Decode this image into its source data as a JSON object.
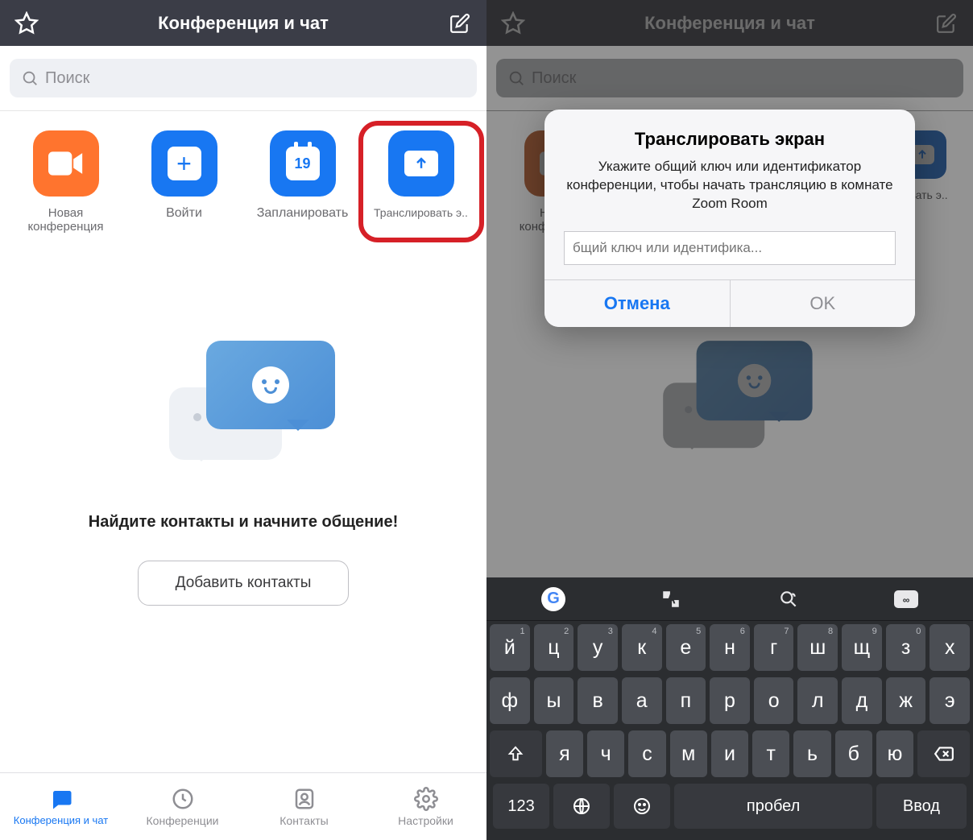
{
  "header": {
    "title": "Конференция и чат"
  },
  "search": {
    "placeholder": "Поиск"
  },
  "actions": {
    "new_meeting": "Новая\nконференция",
    "join": "Войти",
    "schedule": "Запланировать",
    "share": "Транслировать э..",
    "share_short": "ровать э..",
    "calendar_day": "19"
  },
  "empty": {
    "title": "Найдите контакты и начните общение!",
    "button": "Добавить контакты"
  },
  "tabs": {
    "chat": "Конференция и чат",
    "meetings": "Конференции",
    "contacts": "Контакты",
    "settings": "Настройки"
  },
  "dialog": {
    "title": "Транслировать экран",
    "message": "Укажите общий ключ или идентификатор конференции, чтобы начать трансляцию в комнате Zoom Room",
    "placeholder": "бщий ключ или идентифика...",
    "cancel": "Отмена",
    "ok": "OK"
  },
  "keyboard": {
    "row1": [
      "й",
      "ц",
      "у",
      "к",
      "е",
      "н",
      "г",
      "ш",
      "щ",
      "з",
      "х"
    ],
    "row1_sup": [
      "1",
      "2",
      "3",
      "4",
      "5",
      "6",
      "7",
      "8",
      "9",
      "0",
      ""
    ],
    "row2": [
      "ф",
      "ы",
      "в",
      "а",
      "п",
      "р",
      "о",
      "л",
      "д",
      "ж",
      "э"
    ],
    "row3": [
      "я",
      "ч",
      "с",
      "м",
      "и",
      "т",
      "ь",
      "б",
      "ю"
    ],
    "num": "123",
    "space": "пробел",
    "enter": "Ввод"
  }
}
